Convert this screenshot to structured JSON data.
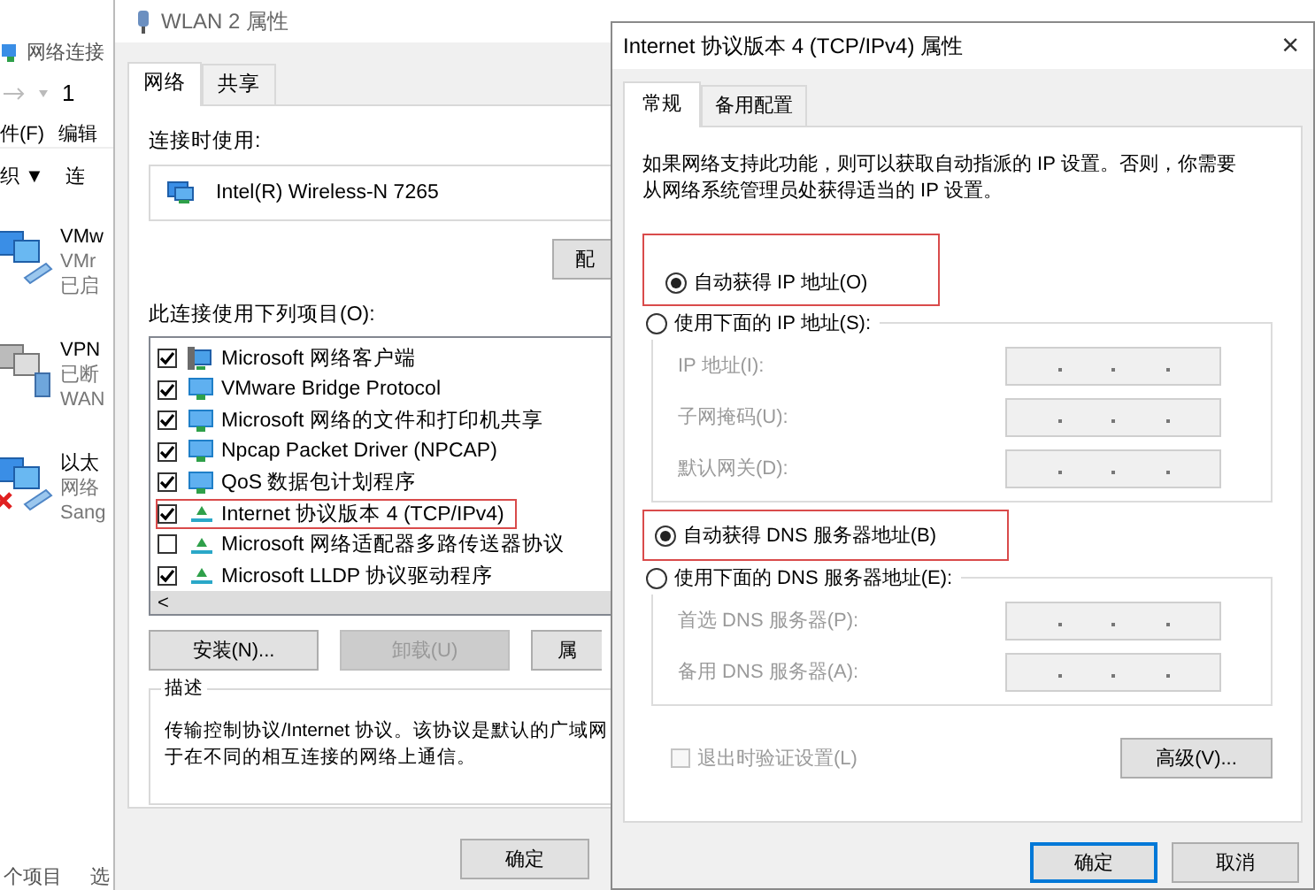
{
  "explorer": {
    "title": "网络连接",
    "address": "1",
    "menu": [
      "件(F)",
      "编辑"
    ],
    "toolbar": [
      "织 ▼",
      "连"
    ],
    "connections": [
      {
        "kind": "adapter",
        "lines": [
          "VMw",
          "VMr",
          "已启"
        ]
      },
      {
        "kind": "vpn",
        "lines": [
          "VPN",
          "已断",
          "WAN"
        ]
      },
      {
        "kind": "disconnected",
        "lines": [
          "以太",
          "网络",
          "Sang"
        ]
      }
    ],
    "status": [
      "个项目",
      "选"
    ]
  },
  "wlan_dialog": {
    "title": "WLAN 2 属性",
    "tabs": [
      {
        "label": "网络",
        "selected": true
      },
      {
        "label": "共享",
        "selected": false
      }
    ],
    "connect_using_label": "连接时使用:",
    "adapter": "Intel(R) Wireless-N 7265",
    "configure_button": "配",
    "items_label": "此连接使用下列项目(O):",
    "items": [
      {
        "kind": "client",
        "label": "Microsoft 网络客户端",
        "checked": true,
        "highlighted": false
      },
      {
        "kind": "service",
        "label": "VMware Bridge Protocol",
        "checked": true,
        "highlighted": false
      },
      {
        "kind": "service",
        "label": "Microsoft 网络的文件和打印机共享",
        "checked": true,
        "highlighted": false
      },
      {
        "kind": "service",
        "label": "Npcap Packet Driver (NPCAP)",
        "checked": true,
        "highlighted": false
      },
      {
        "kind": "service",
        "label": "QoS 数据包计划程序",
        "checked": true,
        "highlighted": false
      },
      {
        "kind": "protocol",
        "label": "Internet 协议版本 4 (TCP/IPv4)",
        "checked": true,
        "highlighted": true
      },
      {
        "kind": "protocol",
        "label": "Microsoft 网络适配器多路传送器协议",
        "checked": false,
        "highlighted": false
      },
      {
        "kind": "protocol",
        "label": "Microsoft LLDP 协议驱动程序",
        "checked": true,
        "highlighted": false
      }
    ],
    "scroll_left": "<",
    "buttons": [
      {
        "label": "安装(N)...",
        "disabled": false
      },
      {
        "label": "卸载(U)",
        "disabled": true
      },
      {
        "label": "属",
        "disabled": false
      }
    ],
    "description_label": "描述",
    "description_lines": [
      "传输控制协议/Internet 协议。该协议是默认的广域网",
      "于在不同的相互连接的网络上通信。"
    ],
    "footer_buttons": [
      "确定"
    ]
  },
  "ipv4_dialog": {
    "title": "Internet 协议版本 4 (TCP/IPv4) 属性",
    "close": "×",
    "tabs": [
      {
        "label": "常规",
        "selected": true
      },
      {
        "label": "备用配置",
        "selected": false
      }
    ],
    "intro": "如果网络支持此功能，则可以获取自动指派的 IP 设置。否则，你需要从网络系统管理员处获得适当的 IP 设置。",
    "ip_mode": [
      {
        "label": "自动获得 IP 地址(O)",
        "selected": true,
        "highlighted": true
      },
      {
        "label": "使用下面的 IP 地址(S):",
        "selected": false,
        "highlighted": false
      }
    ],
    "ip_fields": [
      {
        "label": "IP 地址(I):",
        "disabled": true
      },
      {
        "label": "子网掩码(U):",
        "disabled": true
      },
      {
        "label": "默认网关(D):",
        "disabled": true
      }
    ],
    "dns_mode": [
      {
        "label": "自动获得 DNS 服务器地址(B)",
        "selected": true,
        "highlighted": true
      },
      {
        "label": "使用下面的 DNS 服务器地址(E):",
        "selected": false,
        "highlighted": false
      }
    ],
    "dns_fields": [
      {
        "label": "首选 DNS 服务器(P):",
        "disabled": true
      },
      {
        "label": "备用 DNS 服务器(A):",
        "disabled": true
      }
    ],
    "validate": {
      "label": "退出时验证设置(L)",
      "checked": false,
      "disabled": true
    },
    "advanced_button": "高级(V)...",
    "buttons": [
      {
        "label": "确定",
        "default": true
      },
      {
        "label": "取消",
        "default": false
      }
    ]
  }
}
